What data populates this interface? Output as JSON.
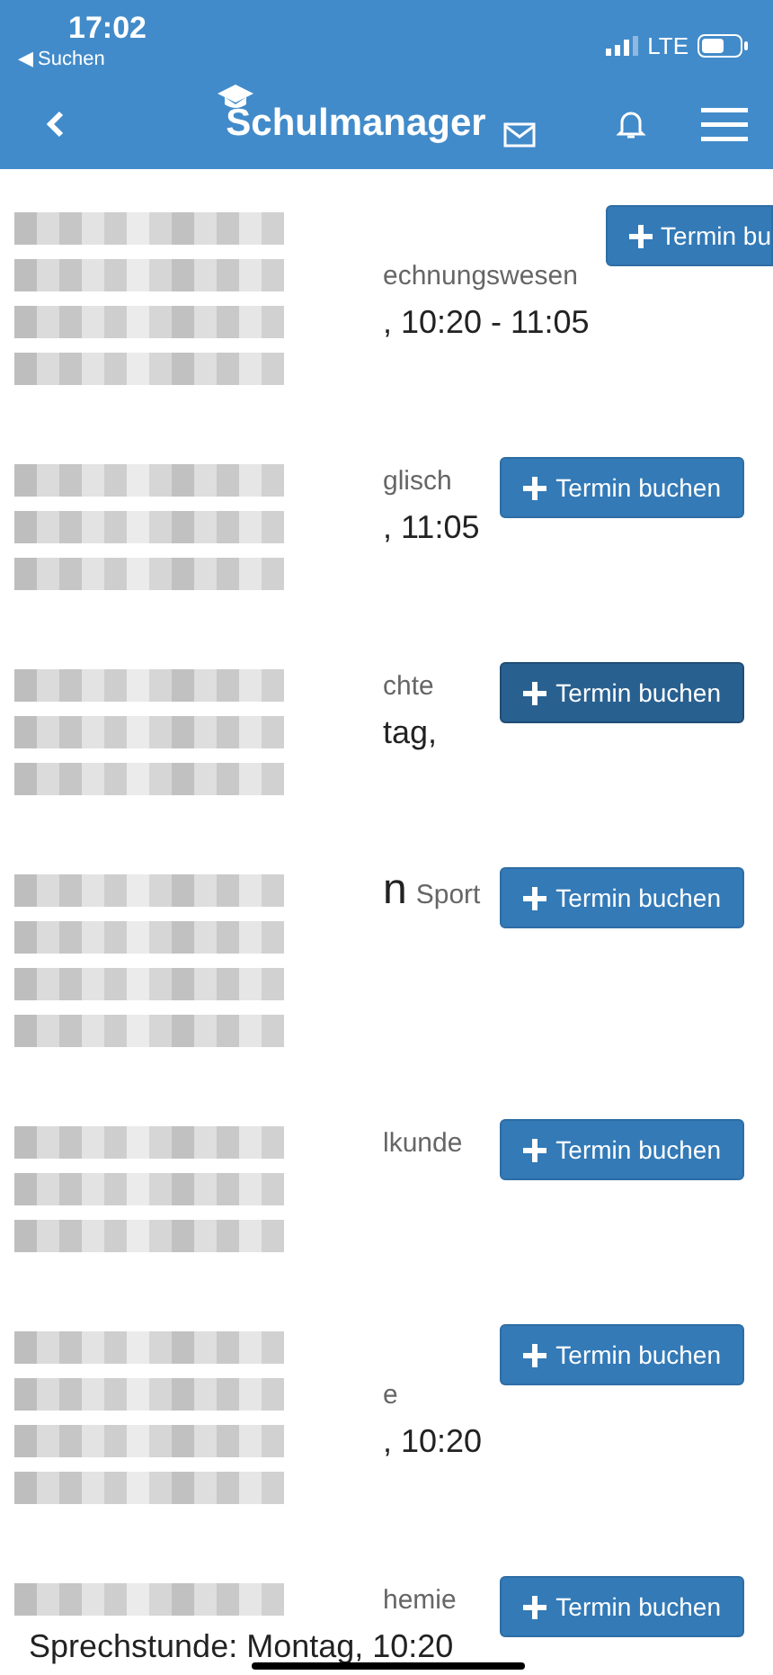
{
  "status_bar": {
    "time": "17:02",
    "back_app": "◀ Suchen",
    "network": "LTE"
  },
  "nav_bar": {
    "title": "Schulmanager"
  },
  "entries": [
    {
      "button": {
        "label": "Termin bu",
        "pressed": false,
        "cut": true
      },
      "rows": [
        {
          "kind": "redacted"
        },
        {
          "kind": "subject",
          "text": "echnungswesen"
        },
        {
          "kind": "time",
          "text": ", 10:20 - 11:05"
        },
        {
          "kind": "redacted"
        }
      ]
    },
    {
      "button": {
        "label": "Termin buchen",
        "pressed": false,
        "cut": false
      },
      "rows": [
        {
          "kind": "subject",
          "text": "glisch"
        },
        {
          "kind": "time",
          "text": ", 11:05"
        },
        {
          "kind": "redacted"
        }
      ]
    },
    {
      "button": {
        "label": "Termin buchen",
        "pressed": true,
        "cut": false
      },
      "rows": [
        {
          "kind": "subject",
          "text": "chte"
        },
        {
          "kind": "time",
          "text": "tag,"
        },
        {
          "kind": "redacted"
        }
      ]
    },
    {
      "button": {
        "label": "Termin buchen",
        "pressed": false,
        "cut": false
      },
      "rows": [
        {
          "kind": "name_subject",
          "name": "n",
          "text": "Sport"
        },
        {
          "kind": "redacted"
        },
        {
          "kind": "redacted"
        },
        {
          "kind": "redacted"
        }
      ]
    },
    {
      "button": {
        "label": "Termin buchen",
        "pressed": false,
        "cut": false
      },
      "rows": [
        {
          "kind": "subject",
          "text": "lkunde"
        },
        {
          "kind": "redacted"
        },
        {
          "kind": "redacted"
        }
      ]
    },
    {
      "button": {
        "label": "Termin buchen",
        "pressed": false,
        "cut": false
      },
      "rows": [
        {
          "kind": "redacted"
        },
        {
          "kind": "subject",
          "text": "e"
        },
        {
          "kind": "time",
          "text": ", 10:20"
        },
        {
          "kind": "redacted"
        }
      ]
    },
    {
      "button": {
        "label": "Termin buchen",
        "pressed": false,
        "cut": false
      },
      "rows": [
        {
          "kind": "subject",
          "text": "hemie"
        },
        {
          "kind": "slot",
          "label": "Sprechstunde:",
          "text": "Montag, 10:20"
        }
      ]
    }
  ]
}
